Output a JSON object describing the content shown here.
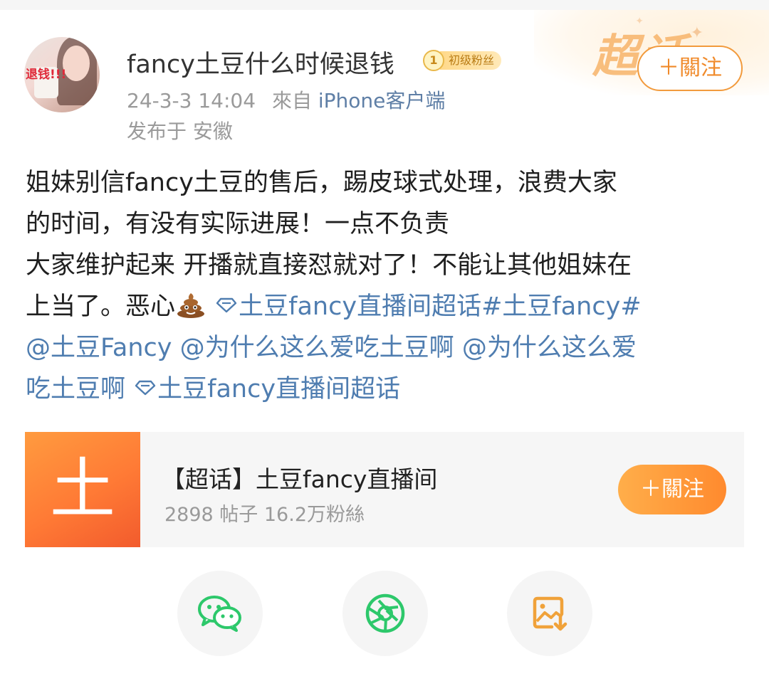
{
  "post": {
    "user_name": "fancy土豆什么时候退钱",
    "badge_label": "初级粉丝",
    "badge_level": "1",
    "avatar_text": "退钱!!!",
    "time": "24-3-3 14:04",
    "source_prefix": "來自",
    "device": "iPhone客户端",
    "region": "发布于 安徽",
    "follow_label": "＋關注",
    "corner_decoration_text": "超话",
    "lines": [
      "姐妹别信fancy土豆的售后，踢皮球式处理，浪费大家",
      "的时间，有没有实际进展！一点不负责",
      "大家维护起来 开播就直接怼就对了！不能让其他姐妹在",
      "上当了。恶心"
    ],
    "topic_link_1": "土豆fancy直播间超话",
    "hashtag": "#土豆fancy#",
    "mention_1": "@土豆Fancy",
    "mention_2": "@为什么这么爱吃土豆啊",
    "mention_3_part1": "@为什么这么爱",
    "mention_3_part2": "吃土豆啊",
    "topic_link_2": "土豆fancy直播间超话",
    "emoji_name": "poop-emoji"
  },
  "topic_card": {
    "thumb_char": "土",
    "title": "【超话】土豆fancy直播间",
    "stats": "2898 帖子 16.2万粉絲",
    "follow_label": "＋關注"
  },
  "share": {
    "icons": [
      "wechat-icon",
      "moments-icon",
      "save-image-icon"
    ]
  },
  "colors": {
    "link": "#4f7db0",
    "accent_orange": "#ff8a2e",
    "meta_gray": "#9a9a9a",
    "wechat_green": "#2dc86b",
    "save_orange": "#f0a23a"
  }
}
